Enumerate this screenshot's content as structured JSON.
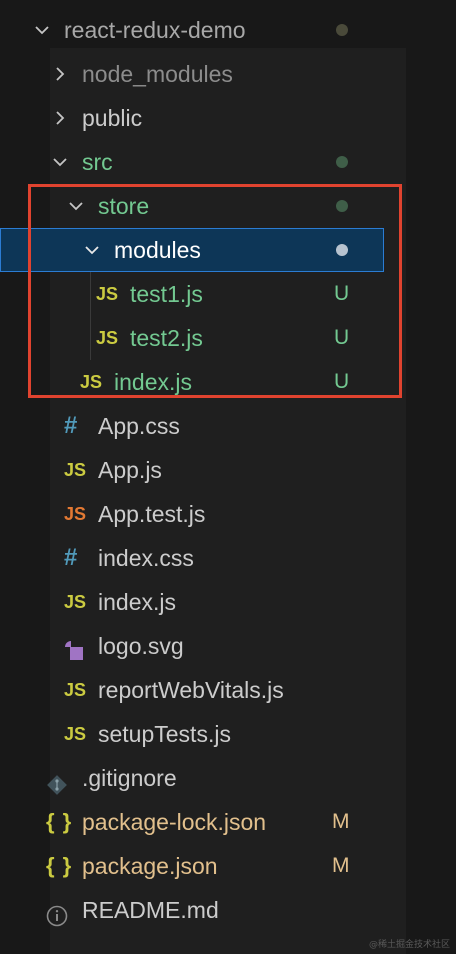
{
  "explorer": {
    "root": {
      "label": "react-redux-demo"
    },
    "items": [
      {
        "label": "node_modules"
      },
      {
        "label": "public"
      },
      {
        "label": "src"
      },
      {
        "label": "store"
      },
      {
        "label": "modules"
      },
      {
        "label": "test1.js",
        "status": "U"
      },
      {
        "label": "test2.js",
        "status": "U"
      },
      {
        "label": "index.js",
        "status": "U"
      },
      {
        "label": "App.css"
      },
      {
        "label": "App.js"
      },
      {
        "label": "App.test.js"
      },
      {
        "label": "index.css"
      },
      {
        "label": "index.js"
      },
      {
        "label": "logo.svg"
      },
      {
        "label": "reportWebVitals.js"
      },
      {
        "label": "setupTests.js"
      },
      {
        "label": ".gitignore"
      },
      {
        "label": "package-lock.json",
        "status": "M"
      },
      {
        "label": "package.json",
        "status": "M"
      },
      {
        "label": "README.md"
      }
    ],
    "icons": {
      "js": "JS",
      "css": "#",
      "json": "{ }",
      "readme": "i"
    }
  },
  "colors": {
    "background": "#181818",
    "untracked": "#73c991",
    "modified": "#e2c08d",
    "selection": "#0d3657",
    "annotation": "#e0432f"
  },
  "watermark": "@稀土掘金技术社区"
}
